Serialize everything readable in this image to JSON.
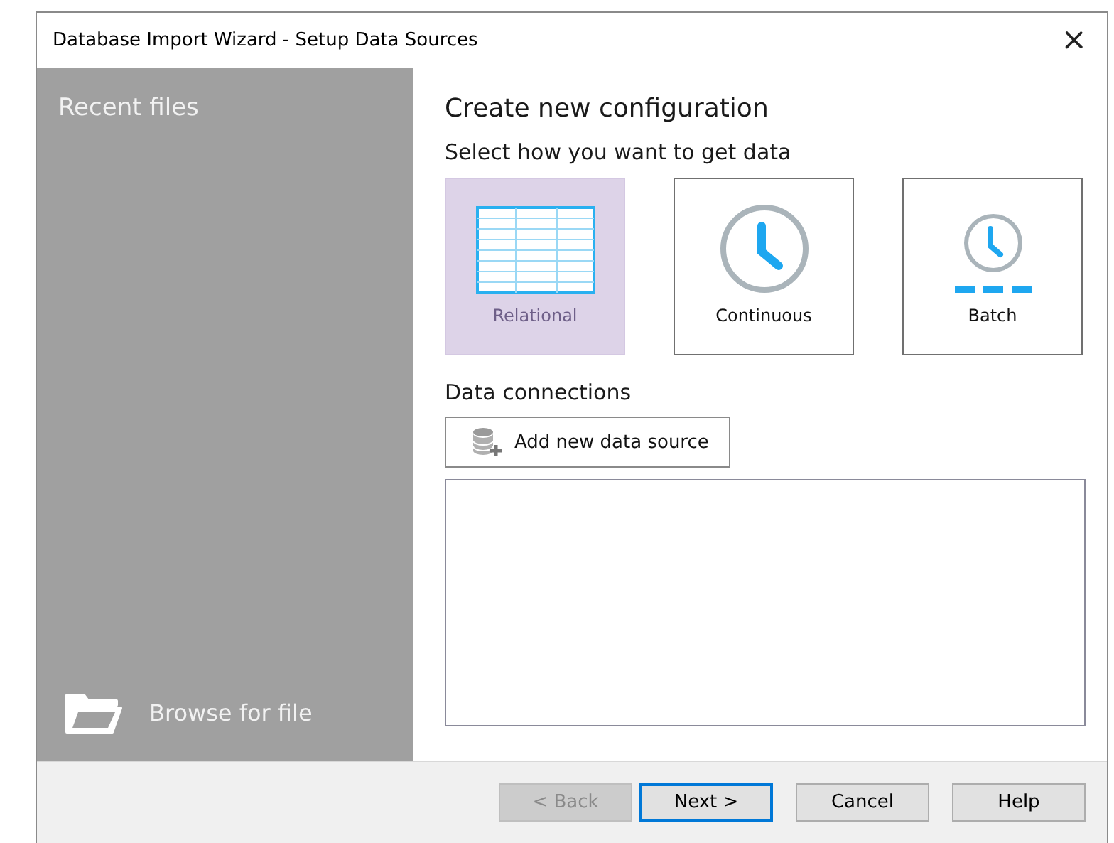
{
  "window": {
    "title": "Database Import Wizard - Setup Data Sources",
    "close": "×"
  },
  "sidebar": {
    "heading": "Recent files",
    "browse": "Browse for file"
  },
  "main": {
    "title": "Create new configuration",
    "subtitle": "Select how you want to get data",
    "options": [
      {
        "kind": "relational",
        "label": "Relational",
        "selected": true
      },
      {
        "kind": "continuous",
        "label": "Continuous",
        "selected": false
      },
      {
        "kind": "batch",
        "label": "Batch",
        "selected": false
      }
    ],
    "connections_label": "Data connections",
    "add_button": "Add new data source"
  },
  "buttons": [
    {
      "label": "< Back",
      "disabled": true,
      "default": false
    },
    {
      "label": "Next >",
      "disabled": false,
      "default": true
    },
    {
      "label": "Cancel",
      "disabled": false,
      "default": false
    },
    {
      "label": "Help",
      "disabled": false,
      "default": false
    }
  ]
}
